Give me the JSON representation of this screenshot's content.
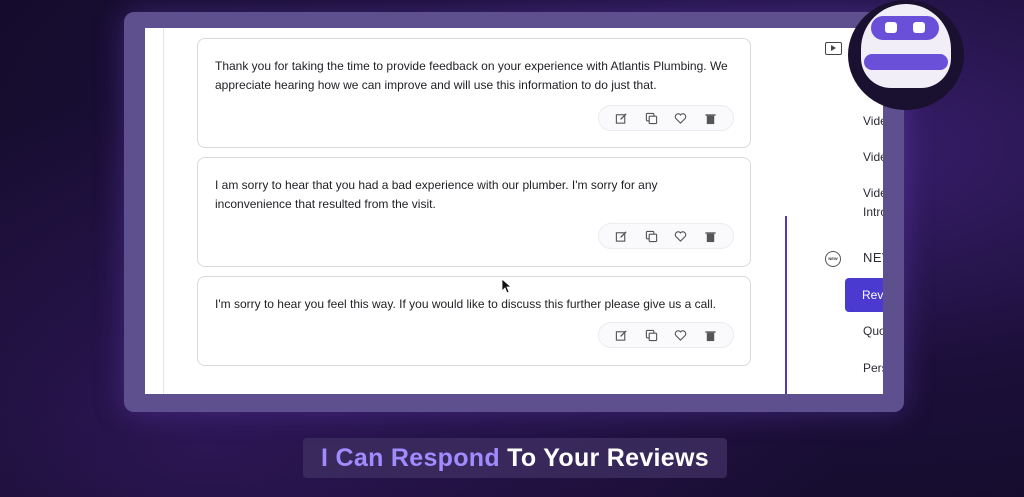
{
  "responses": [
    {
      "text": "Thank you for taking the time to provide feedback on your experience with Atlantis Plumbing. We appreciate hearing how we can improve and will use this information to do just that."
    },
    {
      "text": "I am sorry to hear that you had a bad experience with our plumber. I'm sorry for any inconvenience that resulted from the visit."
    },
    {
      "text": "I'm sorry to hear you feel this way. If you would like to discuss this further please give us a call."
    }
  ],
  "actions": {
    "icons": [
      "edit-icon",
      "copy-icon",
      "heart-icon",
      "trash-icon"
    ]
  },
  "sidebar": {
    "video_items": [
      "Vide",
      "Vide",
      "Vide",
      "Intro"
    ],
    "new_badge": "NEW",
    "new_heading": "NEV",
    "items": [
      {
        "label": "Revi",
        "active": true
      },
      {
        "label": "Quo",
        "active": false
      },
      {
        "label": "Pers",
        "active": false
      }
    ]
  },
  "caption": {
    "highlight": "I Can Respond",
    "rest": " To Your Reviews"
  },
  "colors": {
    "accent": "#4a3ad0",
    "caption_highlight": "#a18cff"
  }
}
